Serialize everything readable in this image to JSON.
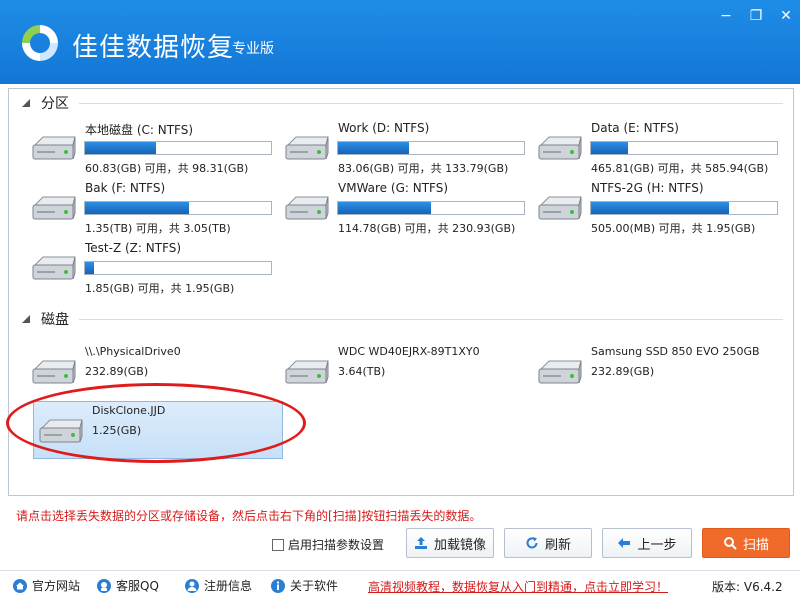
{
  "app": {
    "title": "佳佳数据恢复",
    "edition": "专业版",
    "minimize_glyph": "−",
    "restore_glyph": "❐",
    "close_glyph": "✕"
  },
  "colors": {
    "titlebar": "#1a84e0",
    "accent": "#f06a2a",
    "hint": "#d51b1b",
    "highlight_circle": "#e01b1b"
  },
  "partitions": {
    "title": "分区",
    "items": [
      {
        "name": "本地磁盘 (C: NTFS)",
        "free": "60.83(GB)",
        "total": "98.31(GB)",
        "used_fraction": 0.38
      },
      {
        "name": "Work (D: NTFS)",
        "free": "83.06(GB)",
        "total": "133.79(GB)",
        "used_fraction": 0.38
      },
      {
        "name": "Data (E: NTFS)",
        "free": "465.81(GB)",
        "total": "585.94(GB)",
        "used_fraction": 0.2
      },
      {
        "name": "Bak (F: NTFS)",
        "free": "1.35(TB)",
        "total": "3.05(TB)",
        "used_fraction": 0.56
      },
      {
        "name": "VMWare (G: NTFS)",
        "free": "114.78(GB)",
        "total": "230.93(GB)",
        "used_fraction": 0.5
      },
      {
        "name": "NTFS-2G (H: NTFS)",
        "free": "505.00(MB)",
        "total": "1.95(GB)",
        "used_fraction": 0.74
      },
      {
        "name": "Test-Z (Z: NTFS)",
        "free": "1.85(GB)",
        "total": "1.95(GB)",
        "used_fraction": 0.05
      }
    ],
    "available_label": "可用，共"
  },
  "disks": {
    "title": "磁盘",
    "items": [
      {
        "name": "\\\\.\\PhysicalDrive0",
        "size": "232.89(GB)"
      },
      {
        "name": "WDC WD40EJRX-89T1XY0",
        "size": "3.64(TB)"
      },
      {
        "name": "Samsung SSD 850 EVO 250GB",
        "size": "232.89(GB)"
      },
      {
        "name": "DiskClone.JJD",
        "size": "1.25(GB)",
        "selected": true
      }
    ]
  },
  "hint": "请点击选择丢失数据的分区或存储设备，然后点击右下角的[扫描]按钮扫描丢失的数据。",
  "toolbar": {
    "scan_settings_label": "启用扫描参数设置",
    "load_image_label": "加载镜像",
    "refresh_label": "刷新",
    "back_label": "上一步",
    "scan_label": "扫描"
  },
  "footer": {
    "website": "官方网站",
    "qq": "客服QQ",
    "register": "注册信息",
    "about": "关于软件",
    "promo": "高清视频教程，数据恢复从入门到精通，点击立即学习！",
    "version": "版本: V6.4.2"
  }
}
